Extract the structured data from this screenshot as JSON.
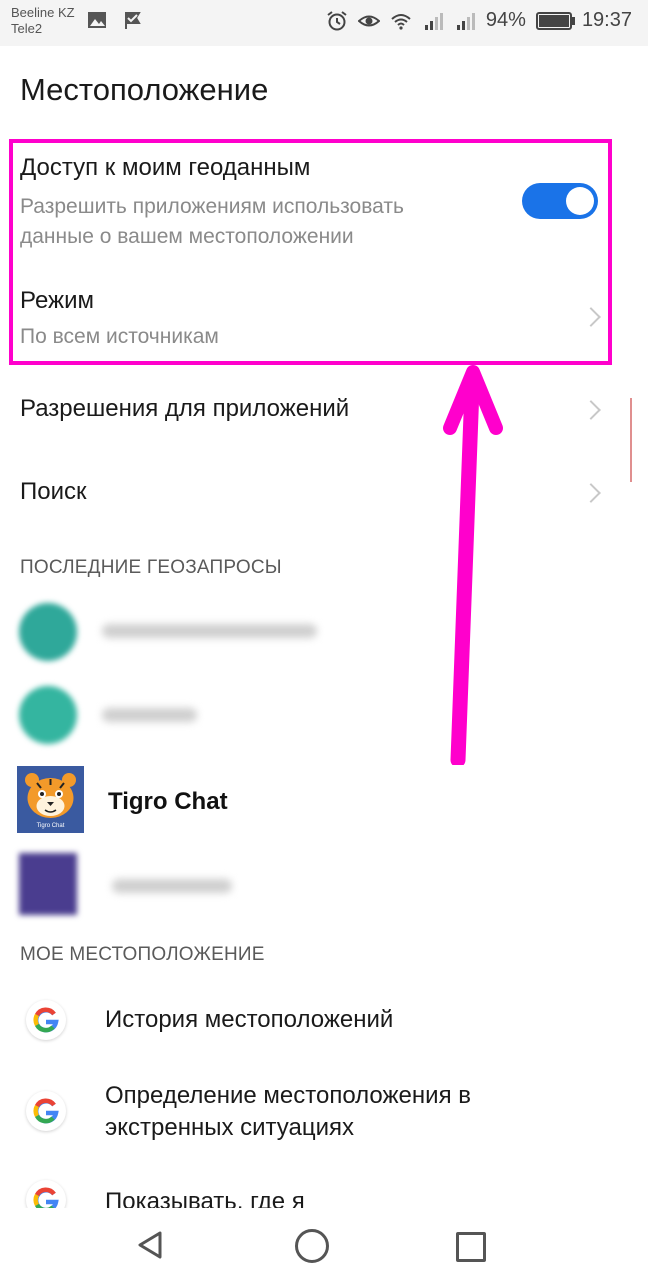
{
  "status_bar": {
    "carrier1": "Beeline KZ",
    "carrier2": "Tele2",
    "battery_percent": "94%",
    "time": "19:37",
    "battery_level": 0.94,
    "icons": [
      "image-icon",
      "check-flag-icon",
      "alarm-icon",
      "eye-icon",
      "wifi-icon",
      "signal-icon",
      "signal-icon",
      "battery-icon"
    ]
  },
  "page_title": "Местоположение",
  "geo_access": {
    "title": "Доступ к моим геоданным",
    "subtitle_line1": "Разрешить приложениям использовать",
    "subtitle_line2": "данные о вашем местоположении",
    "enabled": true,
    "toggle_color": "#1a73e8"
  },
  "mode": {
    "title": "Режим",
    "value": "По всем источникам"
  },
  "app_permissions": {
    "title": "Разрешения для приложений"
  },
  "search": {
    "title": "Поиск"
  },
  "recent_requests": {
    "header": "ПОСЛЕДНИЕ ГЕОЗАПРОСЫ",
    "tigro_label": "Tigro Chat",
    "tigro_small": "Tigro Chat"
  },
  "my_location": {
    "header": "МОЕ МЕСТОПОЛОЖЕНИЕ",
    "items": [
      {
        "line1": "История местоположений",
        "line2": ""
      },
      {
        "line1": "Определение местоположения в",
        "line2": "экстренных ситуациях"
      },
      {
        "line1": "Показывать, где я",
        "line2": ""
      }
    ]
  },
  "annotation": {
    "color": "#ff00cc"
  },
  "navbar": {
    "icons": [
      "back-icon",
      "home-icon",
      "recents-icon"
    ]
  }
}
